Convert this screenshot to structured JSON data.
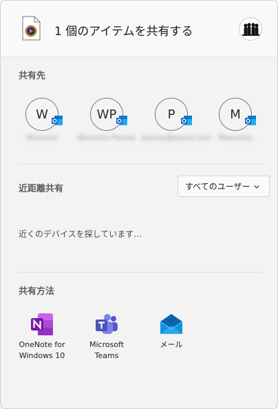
{
  "header": {
    "title": "1 個のアイテムを共有する",
    "file_icon": "media-file-icon",
    "avatar_icon": "user-avatar-icon"
  },
  "share_to": {
    "label": "共有先",
    "contacts": [
      {
        "initials": "W",
        "name": "Wxxxxxx"
      },
      {
        "initials": "WP",
        "name": "Wxxxxxx Pxxxxx"
      },
      {
        "initials": "P",
        "name": "pxxxxx@xxxxx.com"
      },
      {
        "initials": "M",
        "name": "Mxxxxxxx"
      }
    ]
  },
  "nearby": {
    "label": "近距離共有",
    "dropdown_value": "すべてのユーザー",
    "status": "近くのデバイスを探しています..."
  },
  "share_methods": {
    "label": "共有方法",
    "apps": [
      {
        "label_line1": "OneNote for",
        "label_line2": "Windows 10",
        "icon": "onenote-icon"
      },
      {
        "label_line1": "Microsoft",
        "label_line2": "Teams",
        "icon": "teams-icon"
      },
      {
        "label_line1": "メール",
        "label_line2": "",
        "icon": "mail-icon"
      }
    ]
  },
  "colors": {
    "outlook_blue": "#0f6cbd",
    "onenote_purple": "#7719aa",
    "teams_purple": "#5059c9",
    "mail_blue": "#0a64ad"
  }
}
